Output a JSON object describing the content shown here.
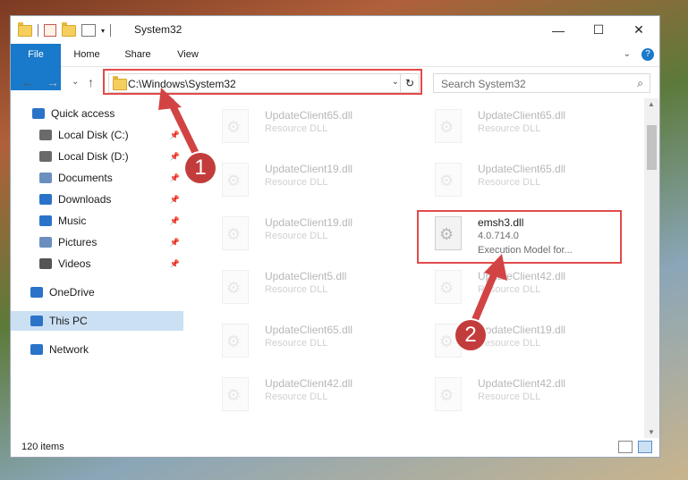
{
  "window": {
    "title": "System32"
  },
  "ribbon": {
    "tabs": [
      "File",
      "Home",
      "Share",
      "View"
    ]
  },
  "address": {
    "path": "C:\\Windows\\System32"
  },
  "search": {
    "placeholder": "Search System32"
  },
  "sidebar": {
    "items": [
      {
        "label": "Quick access",
        "icon": "star-icon"
      },
      {
        "label": "Local Disk (C:)",
        "icon": "drive-icon",
        "pinned": true
      },
      {
        "label": "Local Disk (D:)",
        "icon": "drive-icon",
        "pinned": true
      },
      {
        "label": "Documents",
        "icon": "documents-icon",
        "pinned": true
      },
      {
        "label": "Downloads",
        "icon": "downloads-icon",
        "pinned": true
      },
      {
        "label": "Music",
        "icon": "music-icon",
        "pinned": true
      },
      {
        "label": "Pictures",
        "icon": "pictures-icon",
        "pinned": true
      },
      {
        "label": "Videos",
        "icon": "videos-icon",
        "pinned": true
      },
      {
        "label": "OneDrive",
        "icon": "cloud-icon"
      },
      {
        "label": "This PC",
        "icon": "pc-icon",
        "selected": true
      },
      {
        "label": "Network",
        "icon": "network-icon"
      }
    ]
  },
  "files": [
    {
      "name": "UpdateClient65.dll",
      "desc": "Resource DLL"
    },
    {
      "name": "UpdateClient65.dll",
      "desc": "Resource DLL"
    },
    {
      "name": "UpdateClient19.dll",
      "desc": "Resource DLL"
    },
    {
      "name": "UpdateClient65.dll",
      "desc": "Resource DLL"
    },
    {
      "name": "UpdateClient19.dll",
      "desc": "Resource DLL"
    },
    {
      "name": "emsh3.dll",
      "desc": "4.0.714.0",
      "desc2": "Execution Model for..."
    },
    {
      "name": "UpdateClient5.dll",
      "desc": "Resource DLL"
    },
    {
      "name": "UpdateClient42.dll",
      "desc": "Resource DLL"
    },
    {
      "name": "UpdateClient65.dll",
      "desc": "Resource DLL"
    },
    {
      "name": "UpdateClient19.dll",
      "desc": "Resource DLL"
    },
    {
      "name": "UpdateClient42.dll",
      "desc": "Resource DLL"
    },
    {
      "name": "UpdateClient42.dll",
      "desc": "Resource DLL"
    }
  ],
  "status": {
    "count": "120 items"
  },
  "annotations": {
    "badge1": "1",
    "badge2": "2"
  }
}
